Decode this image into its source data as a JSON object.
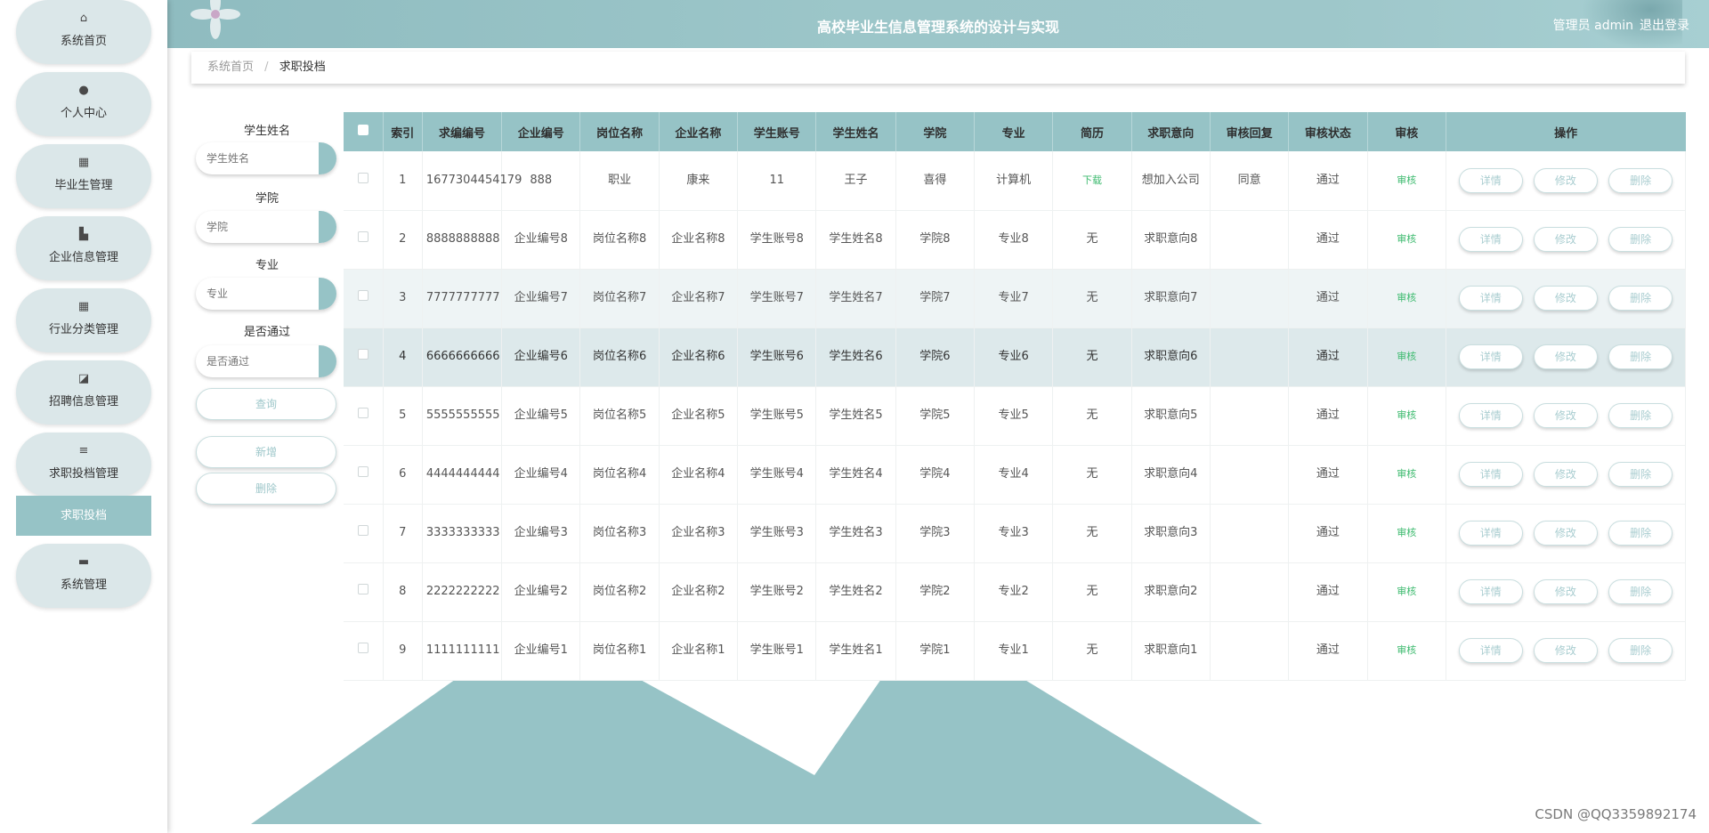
{
  "header": {
    "title": "高校毕业生信息管理系统的设计与实现",
    "user": "管理员 admin",
    "logout": "退出登录"
  },
  "sidebar": {
    "items": [
      {
        "label": "系统首页",
        "icon": "home-icon",
        "glyph": "⌂"
      },
      {
        "label": "个人中心",
        "icon": "person-icon",
        "glyph": "●"
      },
      {
        "label": "毕业生管理",
        "icon": "grid-icon",
        "glyph": "▦"
      },
      {
        "label": "企业信息管理",
        "icon": "building-icon",
        "glyph": "▙"
      },
      {
        "label": "行业分类管理",
        "icon": "grid-icon",
        "glyph": "▦"
      },
      {
        "label": "招聘信息管理",
        "icon": "briefcase-icon",
        "glyph": "◪"
      },
      {
        "label": "求职投档管理",
        "icon": "list-icon",
        "glyph": "≡"
      },
      {
        "label": "系统管理",
        "icon": "chat-icon",
        "glyph": "▬"
      }
    ],
    "submenu": {
      "label": "求职投档"
    }
  },
  "breadcrumb": {
    "home": "系统首页",
    "separator": "/",
    "current": "求职投档"
  },
  "search": {
    "student_name_label": "学生姓名",
    "student_name_placeholder": "学生姓名",
    "college_label": "学院",
    "college_placeholder": "学院",
    "major_label": "专业",
    "major_placeholder": "专业",
    "passed_label": "是否通过",
    "passed_placeholder": "是否通过",
    "query_button": "查询",
    "add_button": "新增",
    "delete_button": "删除"
  },
  "table": {
    "columns": [
      "索引",
      "求编编号",
      "企业编号",
      "岗位名称",
      "企业名称",
      "学生账号",
      "学生姓名",
      "学院",
      "专业",
      "简历",
      "求职意向",
      "审核回复",
      "审核状态",
      "审核",
      "操作"
    ],
    "action_labels": {
      "detail": "详情",
      "edit": "修改",
      "delete": "删除",
      "review": "审核"
    },
    "rows": [
      {
        "index": "1",
        "apply_no": "1677304454179",
        "company_no": "888",
        "position": "职业",
        "company": "康来",
        "account": "11",
        "name": "王子",
        "college": "喜得",
        "major": "计算机",
        "resume": "下载",
        "intention": "想加入公司",
        "reply": "同意",
        "status": "通过"
      },
      {
        "index": "2",
        "apply_no": "8888888888",
        "company_no": "企业编号8",
        "position": "岗位名称8",
        "company": "企业名称8",
        "account": "学生账号8",
        "name": "学生姓名8",
        "college": "学院8",
        "major": "专业8",
        "resume": "无",
        "intention": "求职意向8",
        "reply": "",
        "status": "通过"
      },
      {
        "index": "3",
        "apply_no": "7777777777",
        "company_no": "企业编号7",
        "position": "岗位名称7",
        "company": "企业名称7",
        "account": "学生账号7",
        "name": "学生姓名7",
        "college": "学院7",
        "major": "专业7",
        "resume": "无",
        "intention": "求职意向7",
        "reply": "",
        "status": "通过"
      },
      {
        "index": "4",
        "apply_no": "6666666666",
        "company_no": "企业编号6",
        "position": "岗位名称6",
        "company": "企业名称6",
        "account": "学生账号6",
        "name": "学生姓名6",
        "college": "学院6",
        "major": "专业6",
        "resume": "无",
        "intention": "求职意向6",
        "reply": "",
        "status": "通过"
      },
      {
        "index": "5",
        "apply_no": "5555555555",
        "company_no": "企业编号5",
        "position": "岗位名称5",
        "company": "企业名称5",
        "account": "学生账号5",
        "name": "学生姓名5",
        "college": "学院5",
        "major": "专业5",
        "resume": "无",
        "intention": "求职意向5",
        "reply": "",
        "status": "通过"
      },
      {
        "index": "6",
        "apply_no": "4444444444",
        "company_no": "企业编号4",
        "position": "岗位名称4",
        "company": "企业名称4",
        "account": "学生账号4",
        "name": "学生姓名4",
        "college": "学院4",
        "major": "专业4",
        "resume": "无",
        "intention": "求职意向4",
        "reply": "",
        "status": "通过"
      },
      {
        "index": "7",
        "apply_no": "3333333333",
        "company_no": "企业编号3",
        "position": "岗位名称3",
        "company": "企业名称3",
        "account": "学生账号3",
        "name": "学生姓名3",
        "college": "学院3",
        "major": "专业3",
        "resume": "无",
        "intention": "求职意向3",
        "reply": "",
        "status": "通过"
      },
      {
        "index": "8",
        "apply_no": "2222222222",
        "company_no": "企业编号2",
        "position": "岗位名称2",
        "company": "企业名称2",
        "account": "学生账号2",
        "name": "学生姓名2",
        "college": "学院2",
        "major": "专业2",
        "resume": "无",
        "intention": "求职意向2",
        "reply": "",
        "status": "通过"
      },
      {
        "index": "9",
        "apply_no": "1111111111",
        "company_no": "企业编号1",
        "position": "岗位名称1",
        "company": "企业名称1",
        "account": "学生账号1",
        "name": "学生姓名1",
        "college": "学院1",
        "major": "专业1",
        "resume": "无",
        "intention": "求职意向1",
        "reply": "",
        "status": "通过"
      }
    ]
  },
  "watermark": "CSDN @QQ3359892174",
  "colors": {
    "accent": "#96c3c6",
    "sidebar_item_bg": "#dbe7e9",
    "green_link": "#3cba6e"
  }
}
